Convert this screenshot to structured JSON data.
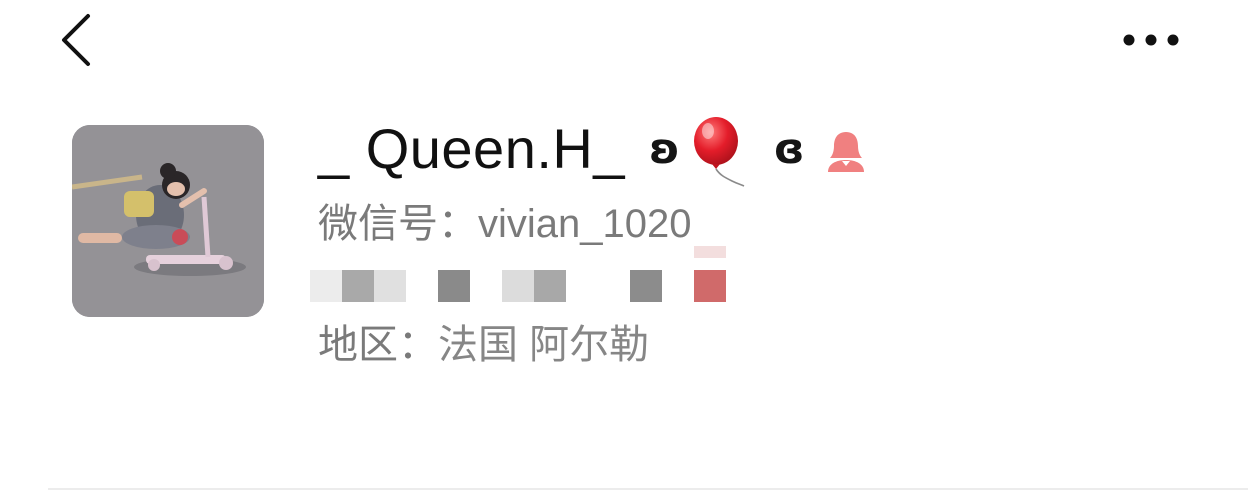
{
  "header": {
    "back_icon": "chevron-left-icon",
    "more_icon": "more-dots-icon"
  },
  "profile": {
    "avatar_icon": "avatar-photo",
    "nickname": "_ Queen.H_",
    "nickname_glyph_left": "ʚ",
    "nickname_glyph_right": "ɞ",
    "balloon_icon": "balloon-emoji-icon",
    "gender_icon": "female-user-icon",
    "gender_color": "#f08080",
    "wechat_id_label": "微信号：",
    "wechat_id_value": "vivian_1020",
    "region_label": "地区：",
    "region_value": "法国 阿尔勒"
  }
}
